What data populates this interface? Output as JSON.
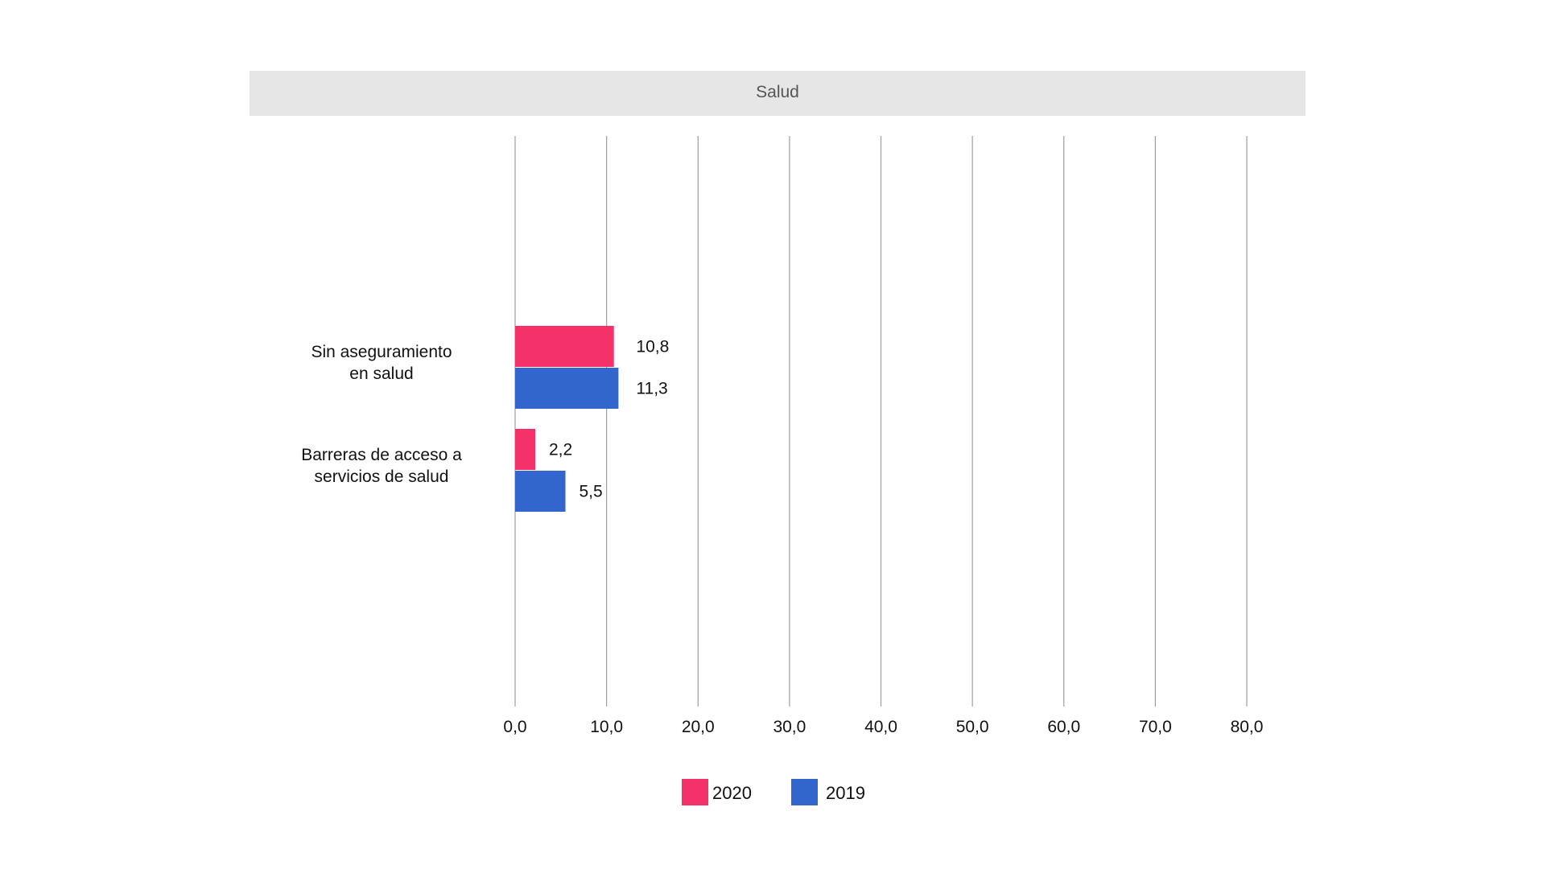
{
  "chart_data": {
    "type": "bar",
    "orientation": "horizontal",
    "title": "Salud",
    "categories": [
      [
        "Sin aseguramiento",
        "en salud"
      ],
      [
        "Barreras de acceso a",
        "servicios de salud"
      ]
    ],
    "series": [
      {
        "name": "2020",
        "color": "#f43169",
        "values": [
          10.8,
          2.2
        ],
        "labels": [
          "10,8",
          "2,2"
        ]
      },
      {
        "name": "2019",
        "color": "#3366cc",
        "values": [
          11.3,
          5.5
        ],
        "labels": [
          "11,3",
          "5,5"
        ]
      }
    ],
    "xlim": [
      0,
      80
    ],
    "xticks": [
      0,
      10,
      20,
      30,
      40,
      50,
      60,
      70,
      80
    ],
    "xtick_labels": [
      "0,0",
      "10,0",
      "20,0",
      "30,0",
      "40,0",
      "50,0",
      "60,0",
      "70,0",
      "80,0"
    ],
    "grid": true,
    "legend_position": "bottom",
    "title_band_color": "#e6e6e6",
    "grid_color": "#9e9e9e"
  }
}
